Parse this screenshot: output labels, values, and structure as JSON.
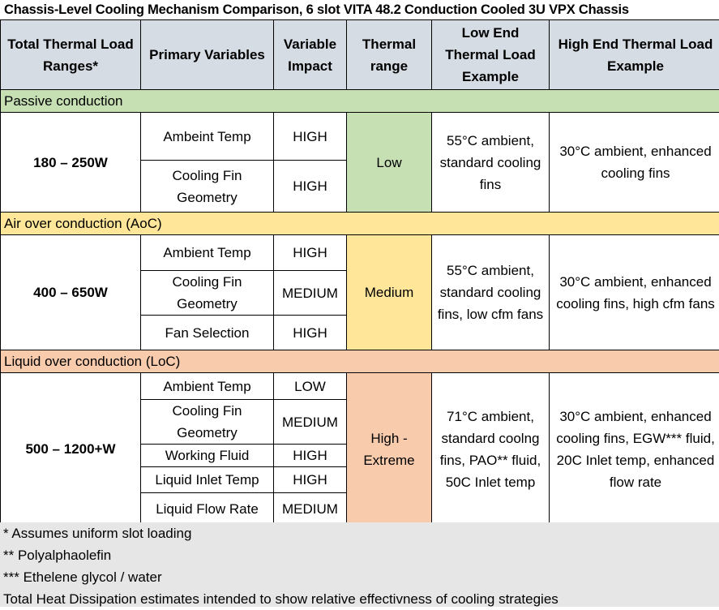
{
  "title": "Chassis-Level Cooling Mechanism Comparison,  6 slot VITA 48.2 Conduction Cooled 3U VPX Chassis",
  "colors": {
    "header_bg": "#d6dce4",
    "passive": "#c6e0b4",
    "aoc": "#ffe699",
    "loc": "#f8cbad",
    "notes_bg": "#e7e6e6"
  },
  "headers": [
    "Total Thermal Load Ranges*",
    "Primary Variables",
    "Variable Impact",
    "Thermal range",
    "Low End Thermal Load Example",
    "High End Thermal Load Example"
  ],
  "sections": [
    {
      "name": "Passive conduction",
      "load_range": "180 – 250W",
      "thermal_range": "Low",
      "low_end_example": "55°C ambient, standard cooling fins",
      "high_end_example": "30°C ambient, enhanced cooling fins",
      "variables": [
        {
          "name": "Ambeint Temp",
          "impact": "HIGH"
        },
        {
          "name": "Cooling Fin Geometry",
          "impact": "HIGH"
        }
      ]
    },
    {
      "name": "Air over conduction (AoC)",
      "load_range": "400 – 650W",
      "thermal_range": "Medium",
      "low_end_example": "55°C ambient, standard cooling fins, low cfm fans",
      "high_end_example": "30°C ambient, enhanced cooling fins, high cfm fans",
      "variables": [
        {
          "name": "Ambient Temp",
          "impact": "HIGH"
        },
        {
          "name": "Cooling Fin Geometry",
          "impact": "MEDIUM"
        },
        {
          "name": "Fan Selection",
          "impact": "HIGH"
        }
      ]
    },
    {
      "name": "Liquid over conduction (LoC)",
      "load_range": "500 – 1200+W",
      "thermal_range": "High - Extreme",
      "low_end_example": "71°C ambient, standard coolng fins, PAO** fluid, 50C Inlet temp",
      "high_end_example": "30°C ambient, enhanced cooling fins, EGW*** fluid, 20C Inlet temp, enhanced flow rate",
      "variables": [
        {
          "name": "Ambient Temp",
          "impact": "LOW"
        },
        {
          "name": "Cooling Fin Geometry",
          "impact": "MEDIUM"
        },
        {
          "name": "Working Fluid",
          "impact": "HIGH"
        },
        {
          "name": "Liquid Inlet Temp",
          "impact": "HIGH"
        },
        {
          "name": "Liquid Flow Rate",
          "impact": "MEDIUM"
        }
      ]
    }
  ],
  "notes": [
    "* Assumes uniform slot loading",
    "** Polyalphaolefin",
    "*** Ethelene glycol / water",
    "Total Heat Dissipation estimates intended to show relative effectivness of cooling strategies"
  ]
}
